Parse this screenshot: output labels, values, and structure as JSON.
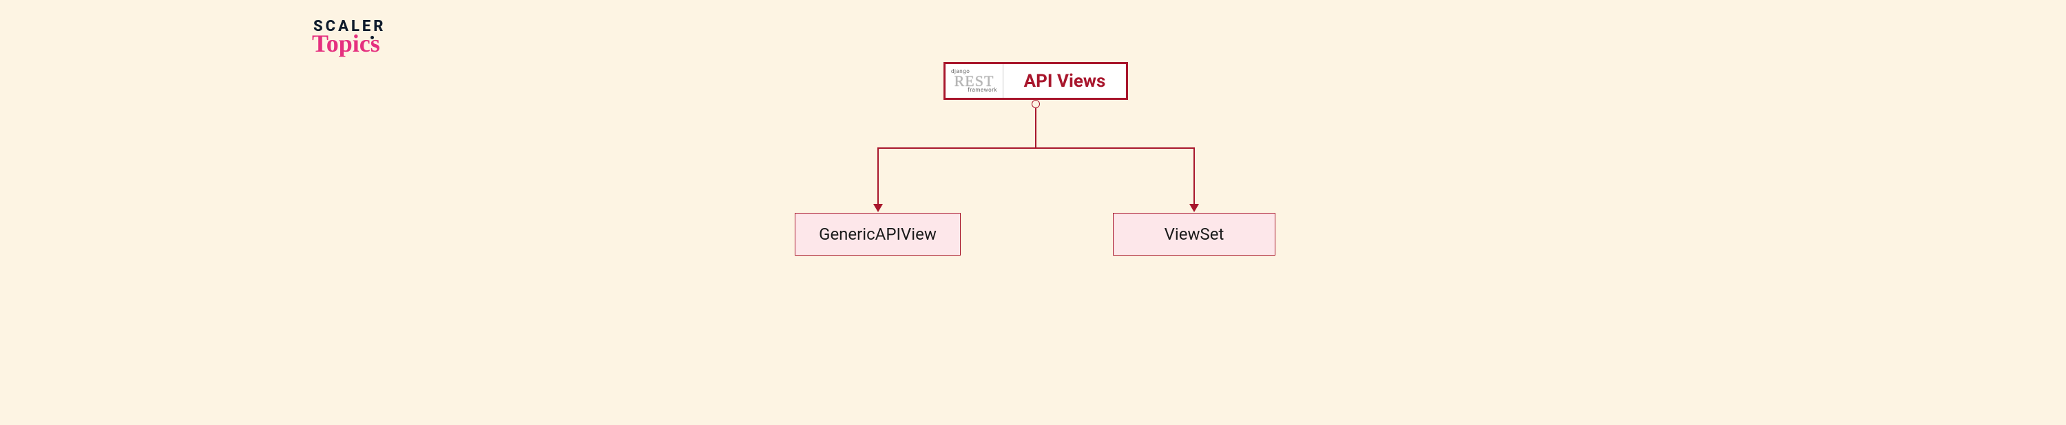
{
  "logo": {
    "line1": "SCALER",
    "line2": "Topics"
  },
  "diagram": {
    "root": {
      "badge": {
        "top": "django",
        "mid": "REST",
        "bottom": "framework"
      },
      "title": "API Views"
    },
    "children": {
      "left": "GenericAPIView",
      "right": "ViewSet"
    }
  }
}
